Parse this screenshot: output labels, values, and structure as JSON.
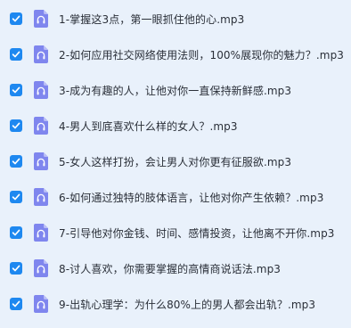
{
  "files": [
    {
      "name": "1-掌握这3点，第一眼抓住他的心.mp3",
      "checked": true,
      "icon": "audio-file-icon"
    },
    {
      "name": "2-如何应用社交网络使用法则，100%展现你的魅力？.mp3",
      "checked": true,
      "icon": "audio-file-icon"
    },
    {
      "name": "3-成为有趣的人，让他对你一直保持新鲜感.mp3",
      "checked": true,
      "icon": "audio-file-icon"
    },
    {
      "name": "4-男人到底喜欢什么样的女人？.mp3",
      "checked": true,
      "icon": "audio-file-icon"
    },
    {
      "name": "5-女人这样打扮，会让男人对你更有征服欲.mp3",
      "checked": true,
      "icon": "audio-file-icon"
    },
    {
      "name": "6-如何通过独特的肢体语言，让他对你产生依赖？.mp3",
      "checked": true,
      "icon": "audio-file-icon"
    },
    {
      "name": "7-引导他对你金钱、时间、感情投资，让他离不开你.mp3",
      "checked": true,
      "icon": "audio-file-icon"
    },
    {
      "name": "8-讨人喜欢，你需要掌握的高情商说话法.mp3",
      "checked": true,
      "icon": "audio-file-icon"
    },
    {
      "name": "9-出轨心理学：为什么80%上的男人都会出轨？.mp3",
      "checked": true,
      "icon": "audio-file-icon"
    }
  ],
  "colors": {
    "background": "#e9f1fb",
    "checkbox": "#1e88f0",
    "file_icon": "#7f86ee"
  }
}
